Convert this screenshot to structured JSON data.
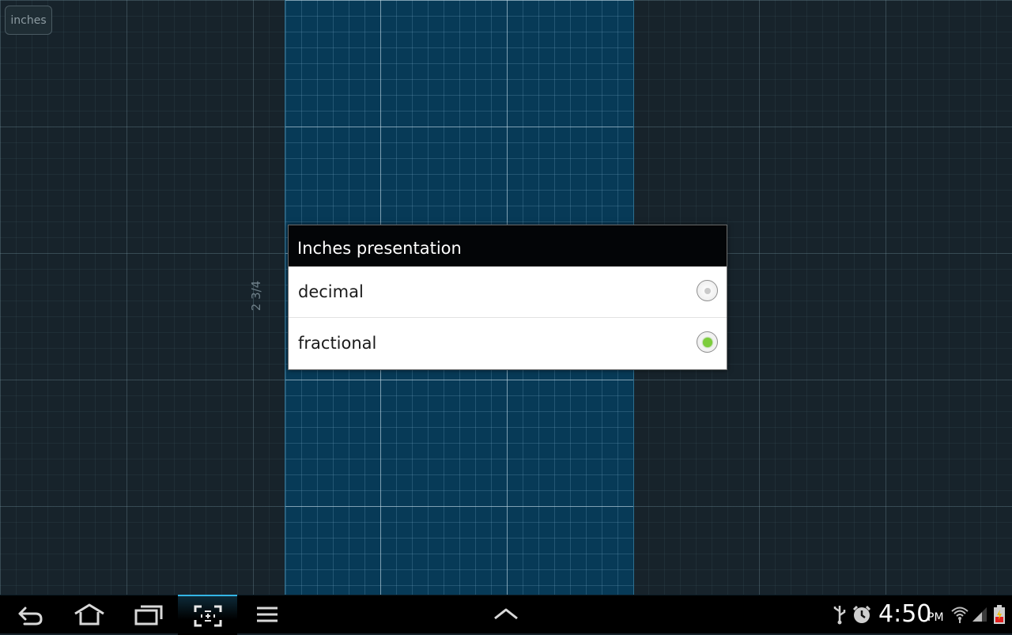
{
  "app": {
    "unit_button_label": "inches",
    "measurement_label": "2 3/4"
  },
  "dialog": {
    "title": "Inches presentation",
    "options": [
      {
        "label": "decimal",
        "selected": false
      },
      {
        "label": "fractional",
        "selected": true
      }
    ],
    "selected_color": "#7ccd3b"
  },
  "navbar": {
    "buttons": [
      "back-icon",
      "home-icon",
      "recent-apps-icon",
      "screen-capture-icon",
      "menu-icon",
      "expand-up-icon"
    ],
    "accent_color": "#33b5e5"
  },
  "status_bar": {
    "time": "4:50",
    "ampm": "PM",
    "icons": [
      "usb-icon",
      "alarm-icon",
      "wifi-icon",
      "signal-icon",
      "battery-icon"
    ]
  }
}
